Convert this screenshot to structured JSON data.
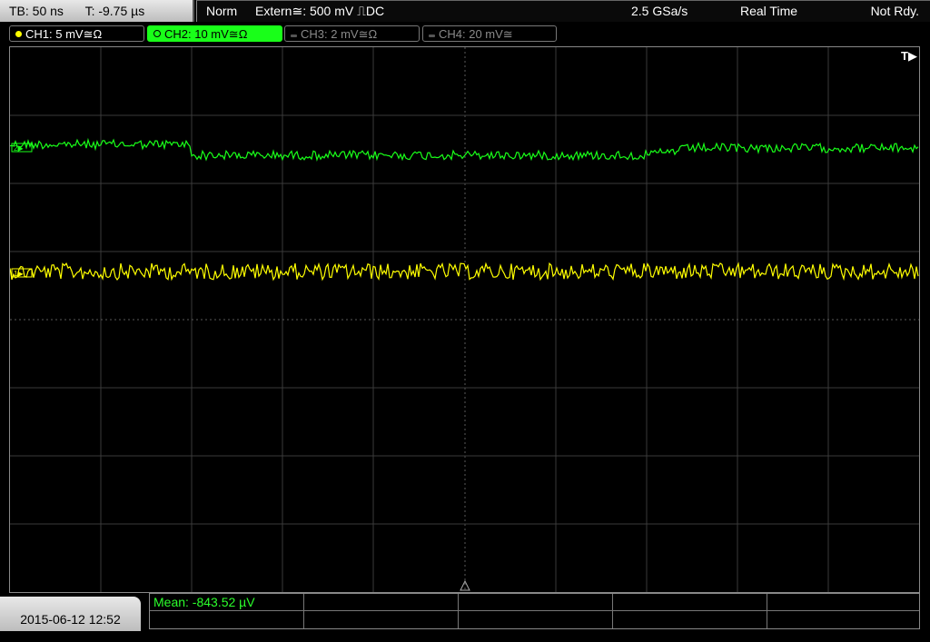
{
  "header": {
    "timebase": "TB: 50 ns",
    "time_offset": "T: -9.75 µs",
    "trigger_mode": "Norm",
    "trigger_source": "Extern≅: 500 mV ⎍DC",
    "sample_rate": "2.5 GSa/s",
    "acquisition": "Real Time",
    "status": "Not Rdy."
  },
  "channels": [
    {
      "label": "CH1: 5 mV≅Ω",
      "color": "#ffff00",
      "active": true
    },
    {
      "label": "CH2: 10 mV≅Ω",
      "color": "#19ff19",
      "active": true,
      "selected": true
    },
    {
      "label": "CH3: 2 mV≅Ω",
      "color": "#8a8a8a",
      "active": false
    },
    {
      "label": "CH4: 20 mV≅",
      "color": "#8a8a8a",
      "active": false
    }
  ],
  "trigger_marker": "T▶",
  "footer": {
    "datetime": "2015-06-12 12:52",
    "measurement": "Mean: -843.52 µV"
  },
  "colors": {
    "ch1": "#ffff00",
    "ch2": "#19ff19",
    "grid": "#3a3a3a",
    "background": "#000000"
  }
}
